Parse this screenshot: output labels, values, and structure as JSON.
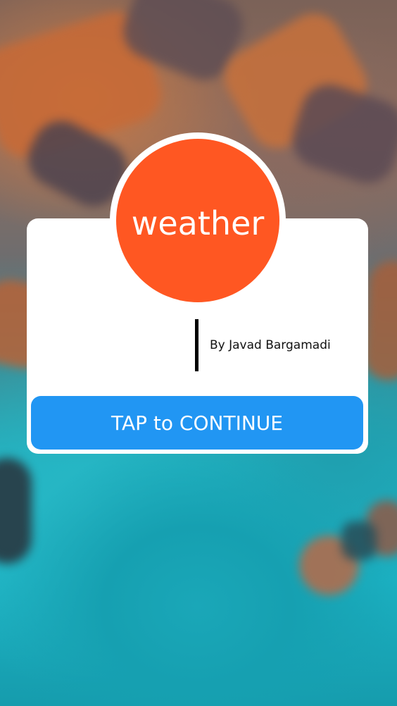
{
  "app": {
    "name": "weather",
    "author": "By Javad Bargamadi",
    "primary_action": "TAP to CONTINUE"
  },
  "colors": {
    "logo_background": "#ff5722",
    "logo_text": "#ffffff",
    "card_background": "#ffffff",
    "button_background": "#2196f3",
    "button_text": "#ffffff",
    "divider": "#000000"
  }
}
